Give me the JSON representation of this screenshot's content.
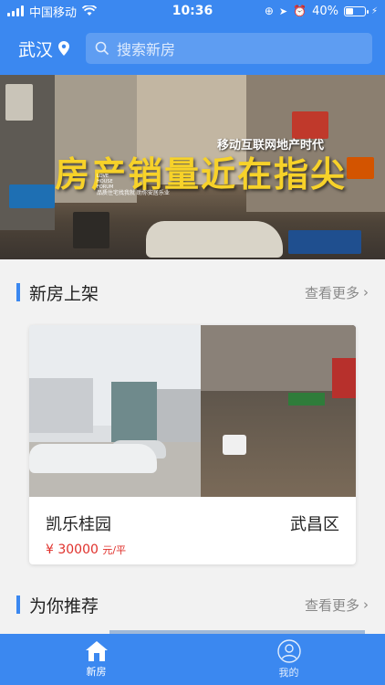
{
  "status_bar": {
    "carrier": "中国移动",
    "time": "10:36",
    "battery_percent": "40%",
    "battery_level": 0.4
  },
  "header": {
    "city": "武汉",
    "search_placeholder": "搜索新房"
  },
  "banner": {
    "headline": "房产销量近在指尖",
    "subhead": "移动互联网地产时代",
    "logo_text": "LOVE HOUSE FORUM",
    "tagline": "品质住宅找我就 助你安居乐业"
  },
  "sections": {
    "new_listings": {
      "title": "新房上架",
      "more": "查看更多"
    },
    "recommended": {
      "title": "为你推荐",
      "more": "查看更多"
    }
  },
  "listing": {
    "name": "凯乐桂园",
    "district": "武昌区",
    "price": "¥ 30000",
    "unit": "元/平"
  },
  "tabs": [
    {
      "label": "新房",
      "icon": "home-icon",
      "active": true
    },
    {
      "label": "我的",
      "icon": "user-icon",
      "active": false
    }
  ],
  "colors": {
    "primary": "#3b88f0",
    "price": "#e0302b",
    "banner_headline": "#f7d229"
  }
}
